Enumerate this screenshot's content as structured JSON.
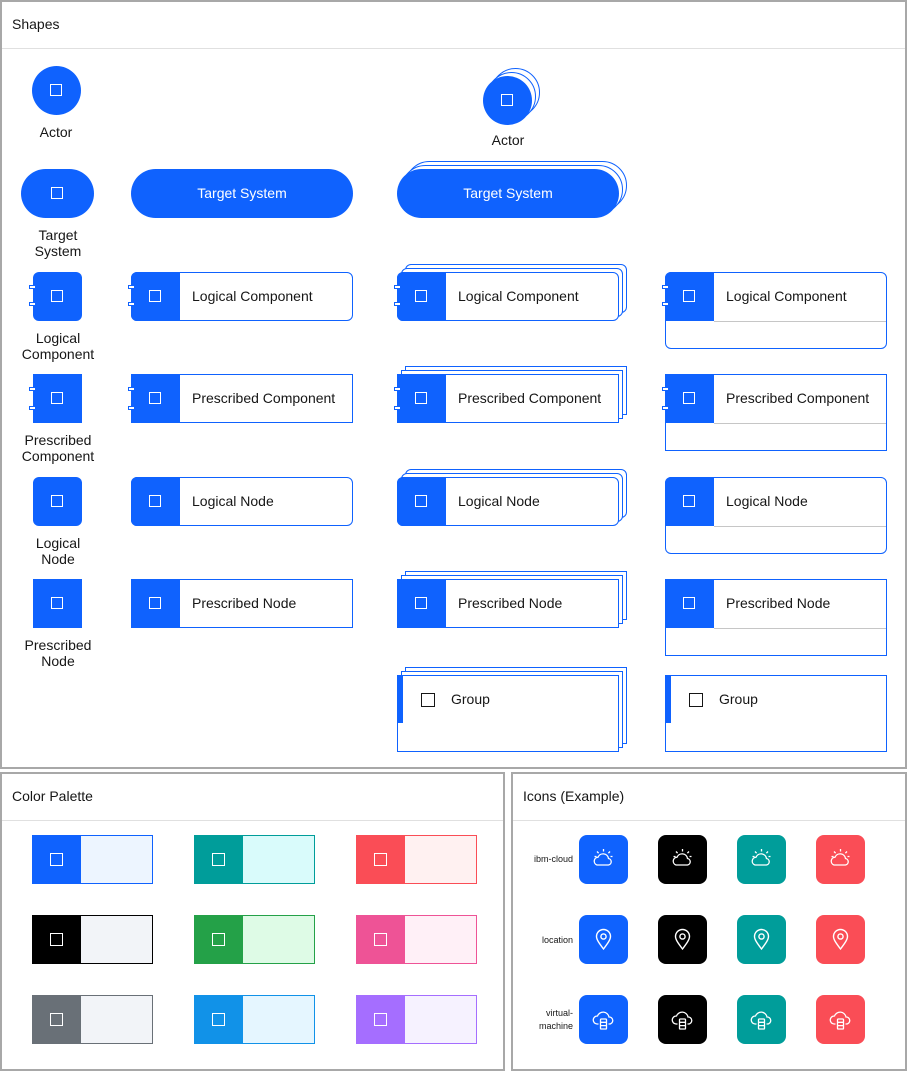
{
  "panels": {
    "shapes_title": "Shapes",
    "palette_title": "Color Palette",
    "icons_title": "Icons (Example)"
  },
  "shapes": {
    "actor": "Actor",
    "actor_stacked": "Actor",
    "target_system_icon_label_line1": "Target",
    "target_system_icon_label_line2": "System",
    "target_system": "Target System",
    "target_system_stacked": "Target System",
    "logical_component_icon_line1": "Logical",
    "logical_component_icon_line2": "Component",
    "logical_component": "Logical Component",
    "prescribed_component_icon_line1": "Prescribed",
    "prescribed_component_icon_line2": "Component",
    "prescribed_component": "Prescribed Component",
    "logical_node_icon_line1": "Logical",
    "logical_node_icon_line2": "Node",
    "logical_node": "Logical Node",
    "prescribed_node_icon_line1": "Prescribed",
    "prescribed_node_icon_line2": "Node",
    "prescribed_node": "Prescribed Node",
    "group": "Group"
  },
  "palette": [
    {
      "head": "#0f62fe",
      "body": "#edf5ff",
      "border": "#0f62fe"
    },
    {
      "head": "#009d9a",
      "body": "#d9fbfb",
      "border": "#009d9a"
    },
    {
      "head": "#fa4d56",
      "body": "#fff1f1",
      "border": "#fa4d56"
    },
    {
      "head": "#000000",
      "body": "#f2f4f8",
      "border": "#000000"
    },
    {
      "head": "#24a148",
      "body": "#defbe6",
      "border": "#24a148"
    },
    {
      "head": "#ee5396",
      "body": "#fff0f7",
      "border": "#ee5396"
    },
    {
      "head": "#697077",
      "body": "#f2f4f8",
      "border": "#697077"
    },
    {
      "head": "#1192e8",
      "body": "#e5f6ff",
      "border": "#1192e8"
    },
    {
      "head": "#a56eff",
      "body": "#f6f2ff",
      "border": "#a56eff"
    }
  ],
  "icons": {
    "rows": [
      {
        "label": "ibm-cloud",
        "icon": "cloud-sun-icon"
      },
      {
        "label": "location",
        "icon": "location-pin-icon"
      },
      {
        "label_line1": "virtual-",
        "label_line2": "machine",
        "icon": "cloud-vm-icon"
      }
    ],
    "colors": [
      "#0f62fe",
      "#000000",
      "#009d9a",
      "#fa4d56"
    ]
  },
  "colors": {
    "primary": "#0f62fe",
    "panel_border": "#a8a8a8"
  }
}
